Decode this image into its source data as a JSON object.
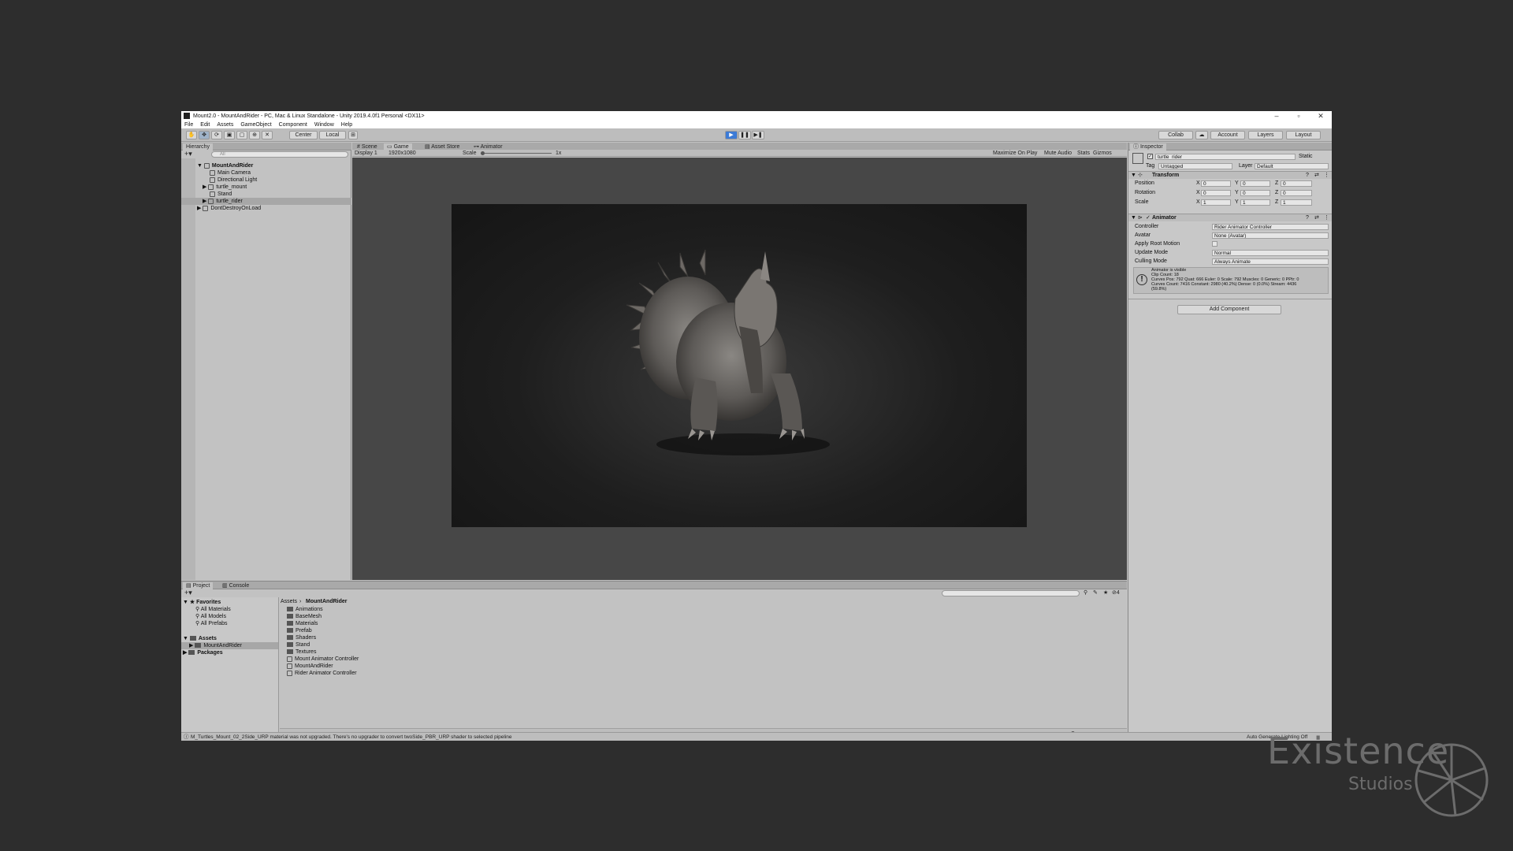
{
  "window": {
    "title": "Mount2.0 - MountAndRider - PC, Mac & Linux Standalone - Unity 2019.4.0f1 Personal <DX11>"
  },
  "menu": [
    "File",
    "Edit",
    "Assets",
    "GameObject",
    "Component",
    "Window",
    "Help"
  ],
  "toolbar": {
    "center": "Center",
    "local": "Local",
    "collab": "Collab",
    "account": "Account",
    "layers": "Layers",
    "layout": "Layout"
  },
  "hierarchy": {
    "tab": "Hierarchy",
    "search_placeholder": "All",
    "items": [
      "MountAndRider",
      "Main Camera",
      "Directional Light",
      "turtle_mount",
      "Stand",
      "turtle_rider",
      "DontDestroyOnLoad"
    ]
  },
  "center_tabs": [
    "Scene",
    "Game",
    "Asset Store",
    "Animator"
  ],
  "game_toolbar": {
    "display": "Display 1",
    "resolution": "1920x1080",
    "scale_label": "Scale",
    "scale_value": "1x",
    "maximize": "Maximize On Play",
    "mute": "Mute Audio",
    "stats": "Stats",
    "gizmos": "Gizmos"
  },
  "inspector": {
    "tab": "Inspector",
    "object_name": "turtle_rider",
    "static": "Static",
    "tag_label": "Tag",
    "tag_value": "Untagged",
    "layer_label": "Layer",
    "layer_value": "Default",
    "transform": {
      "title": "Transform",
      "rows": [
        {
          "label": "Position",
          "x": "0",
          "y": "0",
          "z": "0"
        },
        {
          "label": "Rotation",
          "x": "0",
          "y": "0",
          "z": "0"
        },
        {
          "label": "Scale",
          "x": "1",
          "y": "1",
          "z": "1"
        }
      ]
    },
    "animator": {
      "title": "Animator",
      "rows": [
        {
          "label": "Controller",
          "value": "Rider Animator Controller"
        },
        {
          "label": "Avatar",
          "value": "None (Avatar)"
        },
        {
          "label": "Apply Root Motion",
          "value": ""
        },
        {
          "label": "Update Mode",
          "value": "Normal"
        },
        {
          "label": "Culling Mode",
          "value": "Always Animate"
        }
      ],
      "info": [
        "Animator is visible",
        "Clip Count: 18",
        "Curves Pos: 792 Quat: 666 Euler: 0 Scale: 792 Muscles: 0 Generic: 0 PPtr: 0",
        "Curves Count: 7416 Constant: 2980 (40.2%) Dense: 0 (0.0%) Stream: 4436",
        "(59.8%)"
      ]
    },
    "add_component": "Add Component"
  },
  "project": {
    "tabs": [
      "Project",
      "Console"
    ],
    "favorites": "Favorites",
    "fav_items": [
      "All Materials",
      "All Models",
      "All Prefabs"
    ],
    "assets": "Assets",
    "assets_child": "MountAndRider",
    "packages": "Packages",
    "breadcrumb": [
      "Assets",
      "MountAndRider"
    ],
    "files": [
      "Animations",
      "BaseMesh",
      "Materials",
      "Prefab",
      "Shaders",
      "Stand",
      "Textures",
      "Mount Animator Controller",
      "MountAndRider",
      "Rider Animator Controller"
    ],
    "hidden_count": "4"
  },
  "status": {
    "message": "M_Turtles_Mount_02_2Side_URP material was not upgraded. There's no upgrader to convert twoSide_PBR_URP shader to selected pipeline",
    "right": "Auto Generate Lighting Off"
  },
  "watermark": {
    "brand": "Existence",
    "sub": "Studios"
  }
}
